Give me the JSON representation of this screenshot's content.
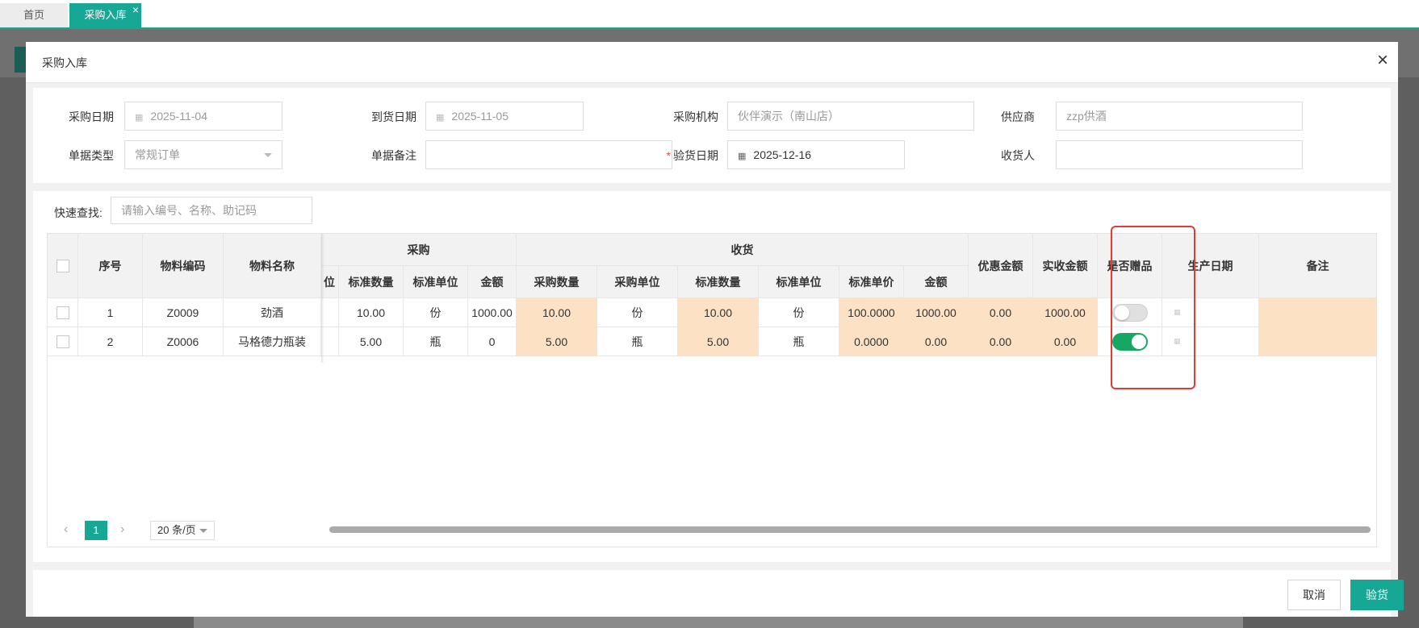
{
  "tabs": {
    "home": "首页",
    "active": "采购入库",
    "close": "×"
  },
  "modal": {
    "title": "采购入库",
    "close": "×"
  },
  "form": {
    "purchase_date": {
      "label": "采购日期",
      "value": "2025-11-04"
    },
    "arrival_date": {
      "label": "到货日期",
      "value": "2025-11-05"
    },
    "purchase_org": {
      "label": "采购机构",
      "value": "伙伴演示（南山店）"
    },
    "supplier": {
      "label": "供应商",
      "value": "zzp供酒"
    },
    "doc_type": {
      "label": "单据类型",
      "value": "常规订单"
    },
    "doc_remark": {
      "label": "单据备注",
      "value": ""
    },
    "inspect_date": {
      "label": "验货日期",
      "required": "*",
      "value": "2025-12-16"
    },
    "receiver": {
      "label": "收货人",
      "value": ""
    }
  },
  "search": {
    "label": "快速查找:",
    "placeholder": "请输入编号、名称、助记码"
  },
  "table": {
    "headers": {
      "seq": "序号",
      "code": "物料编码",
      "name": "物料名称",
      "group_purchase": "采购",
      "group_receive": "收货",
      "p_unit_partial": "位",
      "p_std_qty": "标准数量",
      "p_std_unit": "标准单位",
      "p_amount": "金额",
      "r_qty": "采购数量",
      "r_unit": "采购单位",
      "r_std_qty": "标准数量",
      "r_std_unit": "标准单位",
      "r_std_price": "标准单价",
      "r_amount": "金额",
      "discount": "优惠金额",
      "actual": "实收金额",
      "is_gift": "是否赠品",
      "prod_date": "生产日期",
      "remark": "备注"
    },
    "rows": [
      {
        "seq": "1",
        "code": "Z0009",
        "name": "劲酒",
        "p_std_qty": "10.00",
        "p_std_unit": "份",
        "p_amount": "1000.00",
        "r_qty": "10.00",
        "r_unit": "份",
        "r_std_qty": "10.00",
        "r_std_unit": "份",
        "r_std_price": "100.0000",
        "r_amount": "1000.00",
        "discount": "0.00",
        "actual": "1000.00",
        "is_gift": false
      },
      {
        "seq": "2",
        "code": "Z0006",
        "name": "马格德力瓶装",
        "p_std_qty": "5.00",
        "p_std_unit": "瓶",
        "p_amount": "0",
        "r_qty": "5.00",
        "r_unit": "瓶",
        "r_std_qty": "5.00",
        "r_std_unit": "瓶",
        "r_std_price": "0.0000",
        "r_amount": "0.00",
        "discount": "0.00",
        "actual": "0.00",
        "is_gift": true
      }
    ]
  },
  "pager": {
    "prev": "‹",
    "page": "1",
    "next": "›",
    "page_size": "20 条/页"
  },
  "buttons": {
    "cancel": "取消",
    "confirm": "验货"
  },
  "colors": {
    "accent": "#17a795",
    "toggle_on": "#17a765",
    "highlight": "#fde1c4",
    "annotation_box": "#e53935"
  }
}
